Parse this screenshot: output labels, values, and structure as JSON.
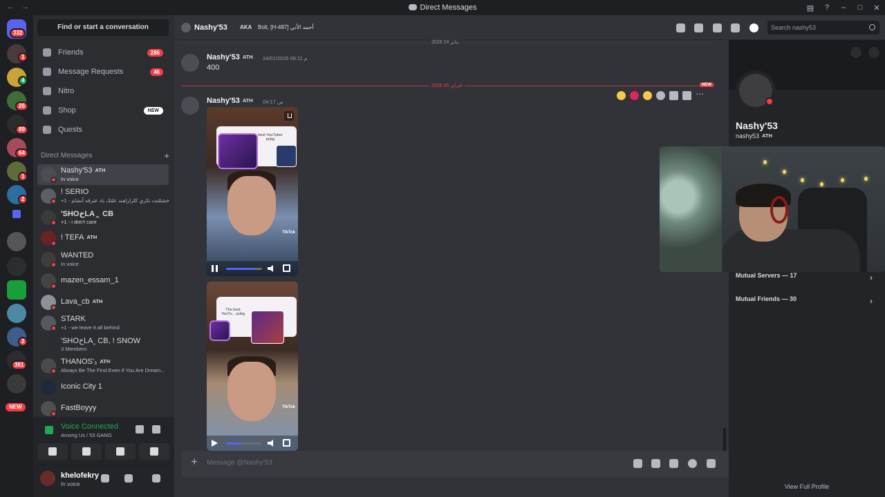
{
  "window": {
    "title": "Direct Messages"
  },
  "guilds": {
    "home_badge": "332",
    "badges": [
      "1",
      "4",
      "26",
      "89",
      "64",
      "1",
      "2",
      "2",
      "361"
    ],
    "new_label": "NEW"
  },
  "sidebar": {
    "search": "Find or start a conversation",
    "nav": [
      {
        "label": "Friends",
        "count": "286"
      },
      {
        "label": "Message Requests",
        "count": "46"
      },
      {
        "label": "Nitro",
        "count": ""
      },
      {
        "label": "Shop",
        "count": "NEW"
      },
      {
        "label": "Quests",
        "count": ""
      }
    ],
    "dm_header": "Direct Messages",
    "dms": [
      {
        "name": "Nashy'53",
        "tag": "ATH",
        "sub": "In voice"
      },
      {
        "name": "! SERIO",
        "tag": "",
        "sub": "+1 - خشمّنت تكري كلزارلفند علتك باد عترقه آنشام"
      },
      {
        "name": "'SHOخLA‸ CB",
        "tag": "",
        "sub": "+1 - i don't care"
      },
      {
        "name": "! TEFA",
        "tag": "ATH",
        "sub": ""
      },
      {
        "name": "WANTED",
        "tag": "",
        "sub": "In voice"
      },
      {
        "name": "mazen_essam_1",
        "tag": "",
        "sub": ""
      },
      {
        "name": "Lava_cb",
        "tag": "ATH",
        "sub": ""
      },
      {
        "name": "STARK",
        "tag": "",
        "sub": "+1 - we leave it all behind"
      },
      {
        "name": "'SHOخLA‸ CB, ! SNOW",
        "tag": "",
        "sub": "3 Members"
      },
      {
        "name": "THANOS'₃",
        "tag": "ATH",
        "sub": "Always Be The First Even if You Are Dream..."
      },
      {
        "name": "Iconic City 1",
        "tag": "",
        "sub": ""
      },
      {
        "name": "FastBoyyy",
        "tag": "",
        "sub": ""
      }
    ]
  },
  "voice": {
    "status": "Voice Connected",
    "location": "Among Us / 53 GANG"
  },
  "user": {
    "name": "khelofekry",
    "status": "In voice"
  },
  "chat_header": {
    "name": "Nashy'53",
    "aka_label": "AKA",
    "aka_value": "Bolt, [H-487] أحمد الأني",
    "search_placeholder": "Search nashy53"
  },
  "messages": {
    "date_divider_1": "يناير 24 2026",
    "msg1": {
      "author": "Nashy'53",
      "tag": "ATH",
      "time": "24/01/2026 08:11 م",
      "text": "400"
    },
    "date_divider_2": "فبراير 05 2026",
    "new_label": "NEW",
    "msg2": {
      "author": "Nashy'53",
      "tag": "ATH",
      "time": "04:17 ص"
    },
    "video1": {
      "card_text": "best YouTuber pubg",
      "watermark": "TikTok",
      "progress": 0.8,
      "state": "playing"
    },
    "video2": {
      "card_text": "The best YouTu... pubg",
      "watermark": "TikTok",
      "progress": 0.45,
      "state": "paused"
    }
  },
  "composer": {
    "placeholder": "Message @Nashy'53"
  },
  "profile": {
    "name": "Nashy'53",
    "username": "nashy53",
    "tag": "ATH",
    "mutual_servers": "Mutual Servers — 17",
    "mutual_friends": "Mutual Friends — 30",
    "footer": "View Full Profile"
  },
  "colors": {
    "accent": "#5865f2",
    "danger": "#f23f43",
    "online": "#23a55a"
  }
}
